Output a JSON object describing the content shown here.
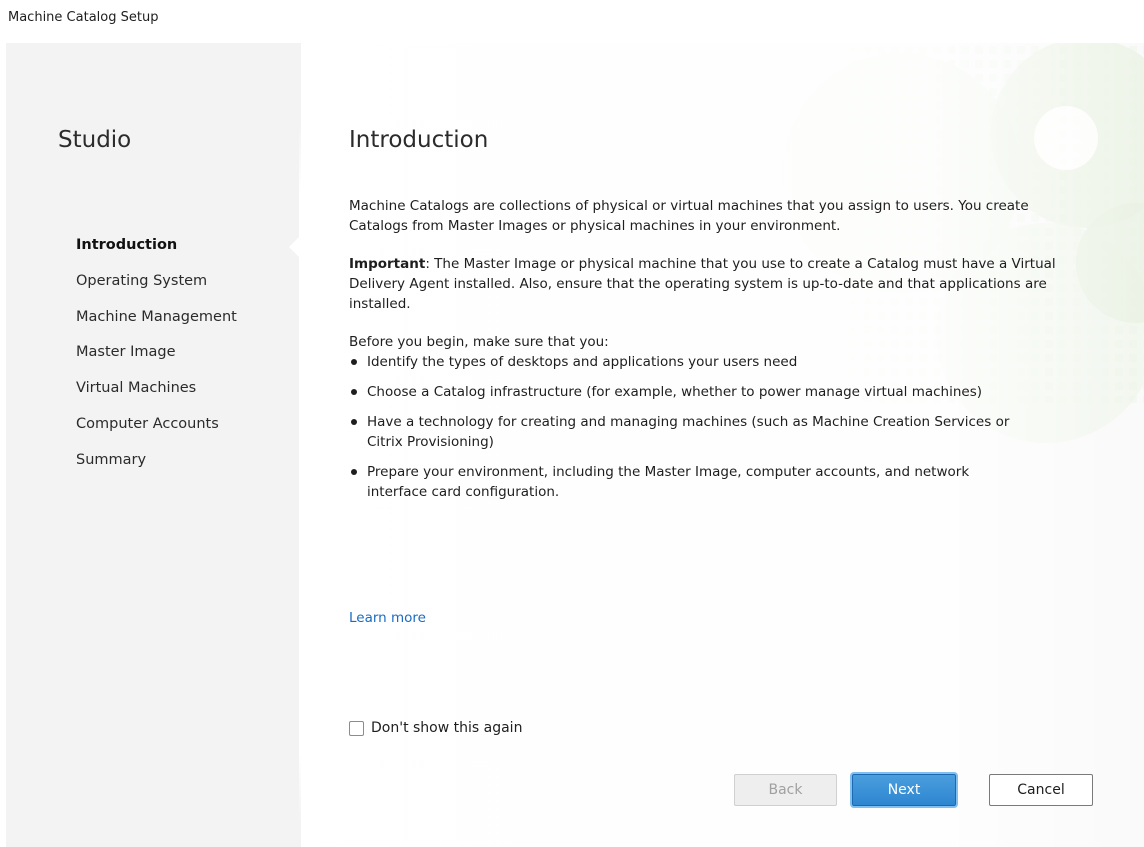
{
  "window": {
    "title": "Machine Catalog Setup"
  },
  "sidebar": {
    "title": "Studio",
    "steps": [
      {
        "label": "Introduction",
        "active": true
      },
      {
        "label": "Operating System",
        "active": false
      },
      {
        "label": "Machine Management",
        "active": false
      },
      {
        "label": "Master Image",
        "active": false
      },
      {
        "label": "Virtual Machines",
        "active": false
      },
      {
        "label": "Computer Accounts",
        "active": false
      },
      {
        "label": "Summary",
        "active": false
      }
    ]
  },
  "main": {
    "title": "Introduction",
    "intro": "Machine Catalogs are collections of physical or virtual machines that you assign to users. You create Catalogs from Master Images or physical machines in your environment.",
    "important_label": "Important",
    "important_text": ": The Master Image or physical machine that you use to create a Catalog must have a Virtual Delivery Agent installed. Also, ensure that the operating system is up-to-date and that applications are installed.",
    "before_begin": "Before you begin, make sure that you:",
    "bullets": [
      "Identify the types of desktops and applications your users need",
      "Choose a Catalog infrastructure (for example, whether to power manage virtual machines)",
      "Have a technology for creating and managing machines (such as Machine Creation Services or Citrix Provisioning)",
      "Prepare your environment, including the Master Image, computer accounts, and network interface card configuration."
    ],
    "learn_more": "Learn more",
    "dont_show_again": "Don't show this again",
    "dont_show_checked": false
  },
  "buttons": {
    "back": "Back",
    "next": "Next",
    "cancel": "Cancel",
    "back_enabled": false
  },
  "colors": {
    "accent": "#2e86d0",
    "link": "#1a6cc2",
    "decoration": "#cfe1c4"
  },
  "icons": {
    "background": "citrix-logo-watermark-icon"
  }
}
